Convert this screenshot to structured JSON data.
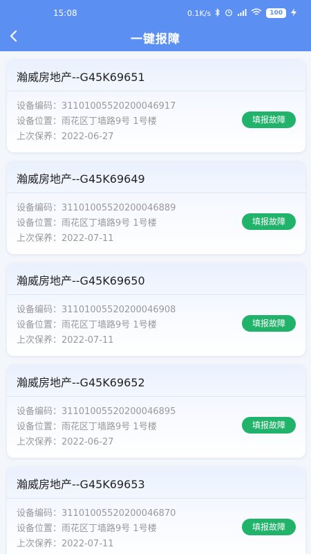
{
  "status_bar": {
    "time": "15:08",
    "net_speed": "0.1K/s",
    "battery": "100"
  },
  "header": {
    "title": "一键报障"
  },
  "labels": {
    "code": "设备编码：",
    "location": "设备位置：",
    "last_maint": "上次保养：",
    "report_button": "填报故障"
  },
  "cards": [
    {
      "title": "瀚威房地产--G45K69651",
      "code": "31101005520200046917",
      "location": "雨花区丁墙路9号 1号楼",
      "last_maint": "2022-06-27"
    },
    {
      "title": "瀚威房地产--G45K69649",
      "code": "31101005520200046889",
      "location": "雨花区丁墙路9号 1号楼",
      "last_maint": "2022-07-11"
    },
    {
      "title": "瀚威房地产--G45K69650",
      "code": "31101005520200046908",
      "location": "雨花区丁墙路9号 1号楼",
      "last_maint": "2022-07-11"
    },
    {
      "title": "瀚威房地产--G45K69652",
      "code": "31101005520200046895",
      "location": "雨花区丁墙路9号 1号楼",
      "last_maint": "2022-06-27"
    },
    {
      "title": "瀚威房地产--G45K69653",
      "code": "31101005520200046870",
      "location": "雨花区丁墙路9号 1号楼",
      "last_maint": "2022-07-11"
    }
  ],
  "colors": {
    "header_bg": "#5b8ff2",
    "button_green": "#22b36b"
  }
}
